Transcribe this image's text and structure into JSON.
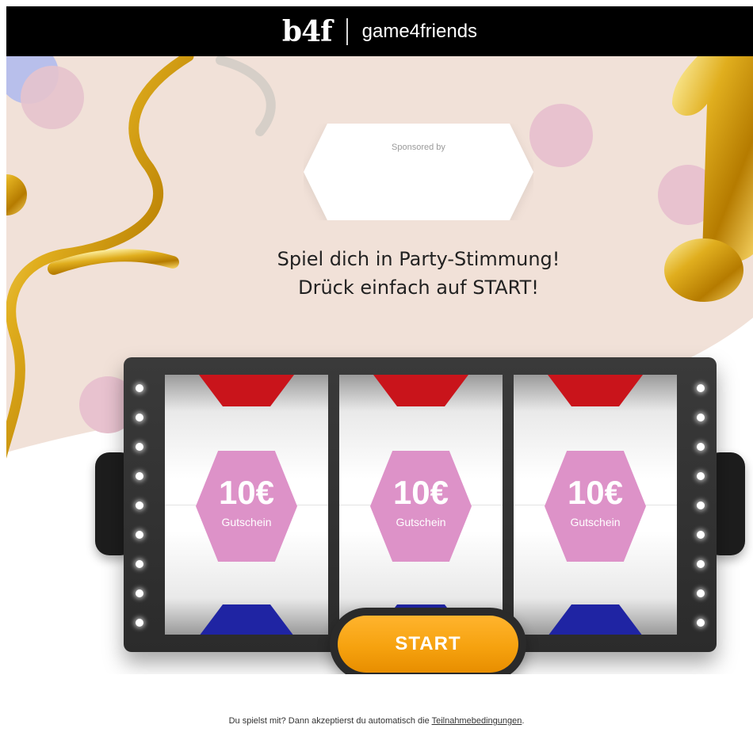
{
  "header": {
    "logo": "b4f",
    "subtitle": "game4friends"
  },
  "sponsor": {
    "label": "Sponsored by"
  },
  "headline": {
    "line1": "Spiel dich in Party-Stimmung!",
    "line2": "Drück einfach auf START!"
  },
  "reels": [
    {
      "amount": "10€",
      "label": "Gutschein"
    },
    {
      "amount": "10€",
      "label": "Gutschein"
    },
    {
      "amount": "10€",
      "label": "Gutschein"
    }
  ],
  "start_button": {
    "label": "START"
  },
  "footer": {
    "text": "Du spielst mit? Dann akzeptierst du automatisch die ",
    "link": "Teilnahmebedingungen",
    "suffix": "."
  },
  "colors": {
    "background": "#f1e1d8",
    "voucher": "#dd92c8",
    "start": "#f6a20f",
    "symbol_top": "#c9141b",
    "symbol_bottom": "#1f24a3"
  }
}
